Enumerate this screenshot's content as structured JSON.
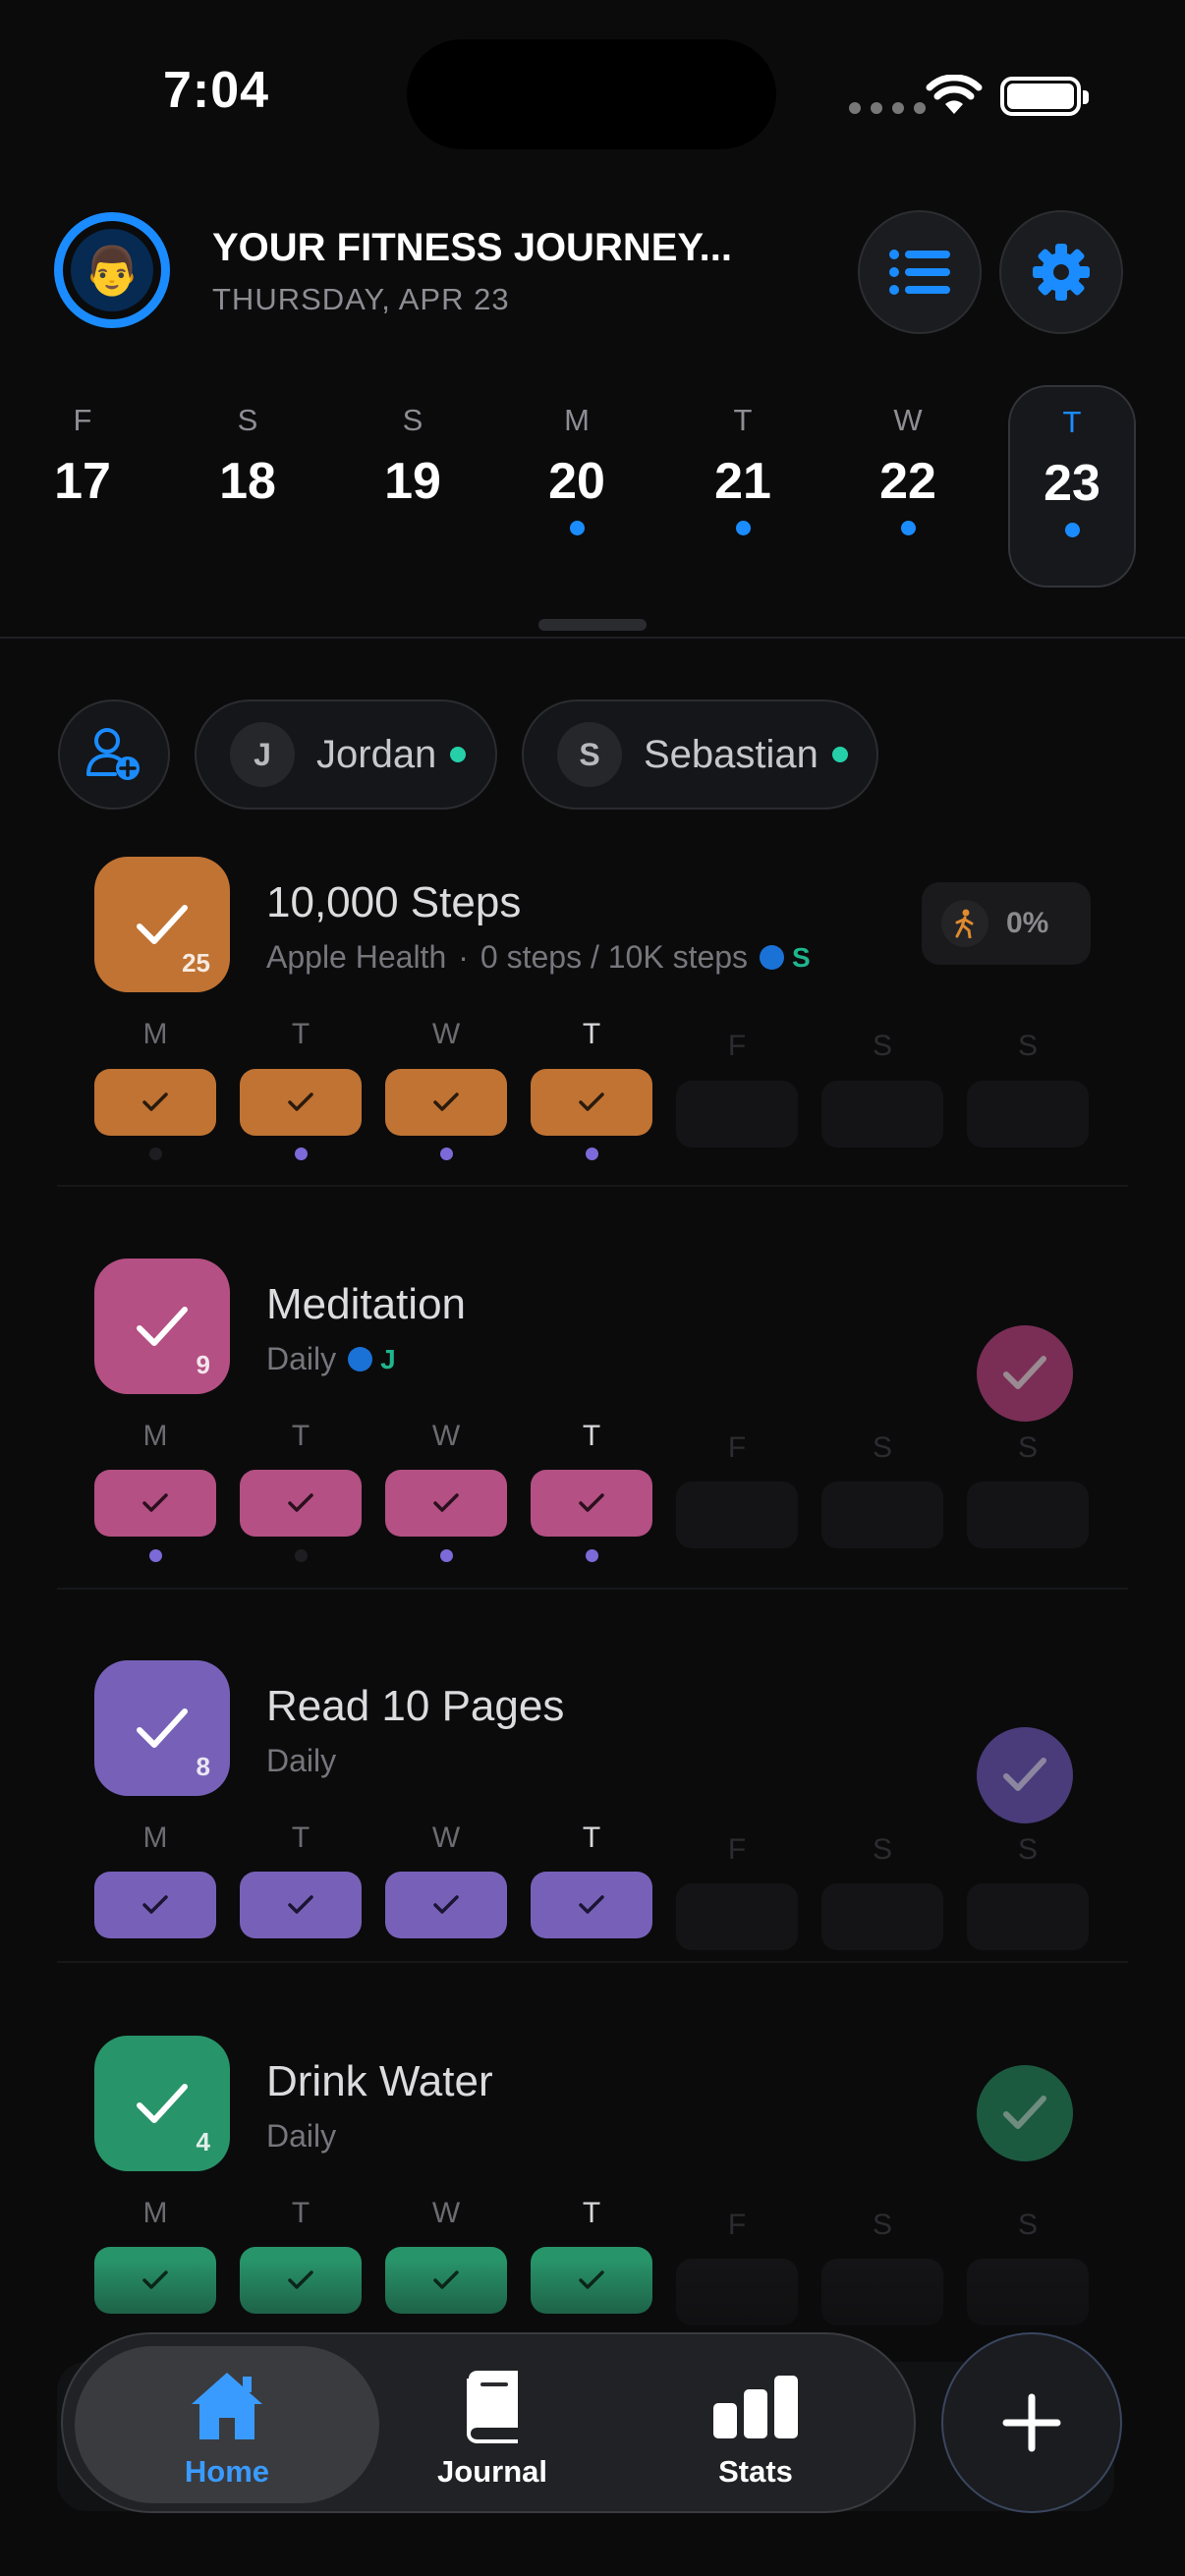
{
  "status": {
    "time": "7:04"
  },
  "header": {
    "avatar_emoji": "👨",
    "title": "YOUR FITNESS JOURNEY...",
    "date": "THURSDAY, APR 23",
    "accent": "#1a8cff"
  },
  "dates": [
    {
      "weekday": "F",
      "day": "17",
      "dot": false
    },
    {
      "weekday": "S",
      "day": "18",
      "dot": false
    },
    {
      "weekday": "S",
      "day": "19",
      "dot": false
    },
    {
      "weekday": "M",
      "day": "20",
      "dot": true
    },
    {
      "weekday": "T",
      "day": "21",
      "dot": true
    },
    {
      "weekday": "W",
      "day": "22",
      "dot": true
    },
    {
      "weekday": "T",
      "day": "23",
      "dot": true,
      "selected": true
    }
  ],
  "friends": [
    {
      "initial": "J",
      "name": "Jordan",
      "online": true
    },
    {
      "initial": "S",
      "name": "Sebastian",
      "online": true
    }
  ],
  "week_letters": [
    "M",
    "T",
    "W",
    "T",
    "F",
    "S",
    "S"
  ],
  "habits": [
    {
      "name": "10,000 Steps",
      "source": "Apple Health",
      "detail": "0 steps / 10K steps",
      "buddy": "S",
      "count": "25",
      "color": "#c07333",
      "progress_label": "0%",
      "completed": [
        true,
        true,
        true,
        true,
        false,
        false,
        false
      ],
      "dots": [
        false,
        true,
        true,
        true,
        false,
        false,
        false
      ]
    },
    {
      "name": "Meditation",
      "source": "Daily",
      "buddy": "J",
      "count": "9",
      "color": "#b45083",
      "completed": [
        true,
        true,
        true,
        true,
        false,
        false,
        false
      ],
      "dots": [
        true,
        false,
        true,
        true,
        false,
        false,
        false
      ]
    },
    {
      "name": "Read 10 Pages",
      "source": "Daily",
      "count": "8",
      "color": "#7761b8",
      "completed": [
        true,
        true,
        true,
        true,
        false,
        false,
        false
      ]
    },
    {
      "name": "Drink Water",
      "source": "Daily",
      "count": "4",
      "color": "#28946a",
      "completed": [
        true,
        true,
        true,
        true,
        false,
        false,
        false
      ]
    }
  ],
  "tabbar": {
    "tabs": [
      {
        "label": "Home",
        "active": true
      },
      {
        "label": "Journal",
        "active": false
      },
      {
        "label": "Stats",
        "active": false
      }
    ]
  }
}
